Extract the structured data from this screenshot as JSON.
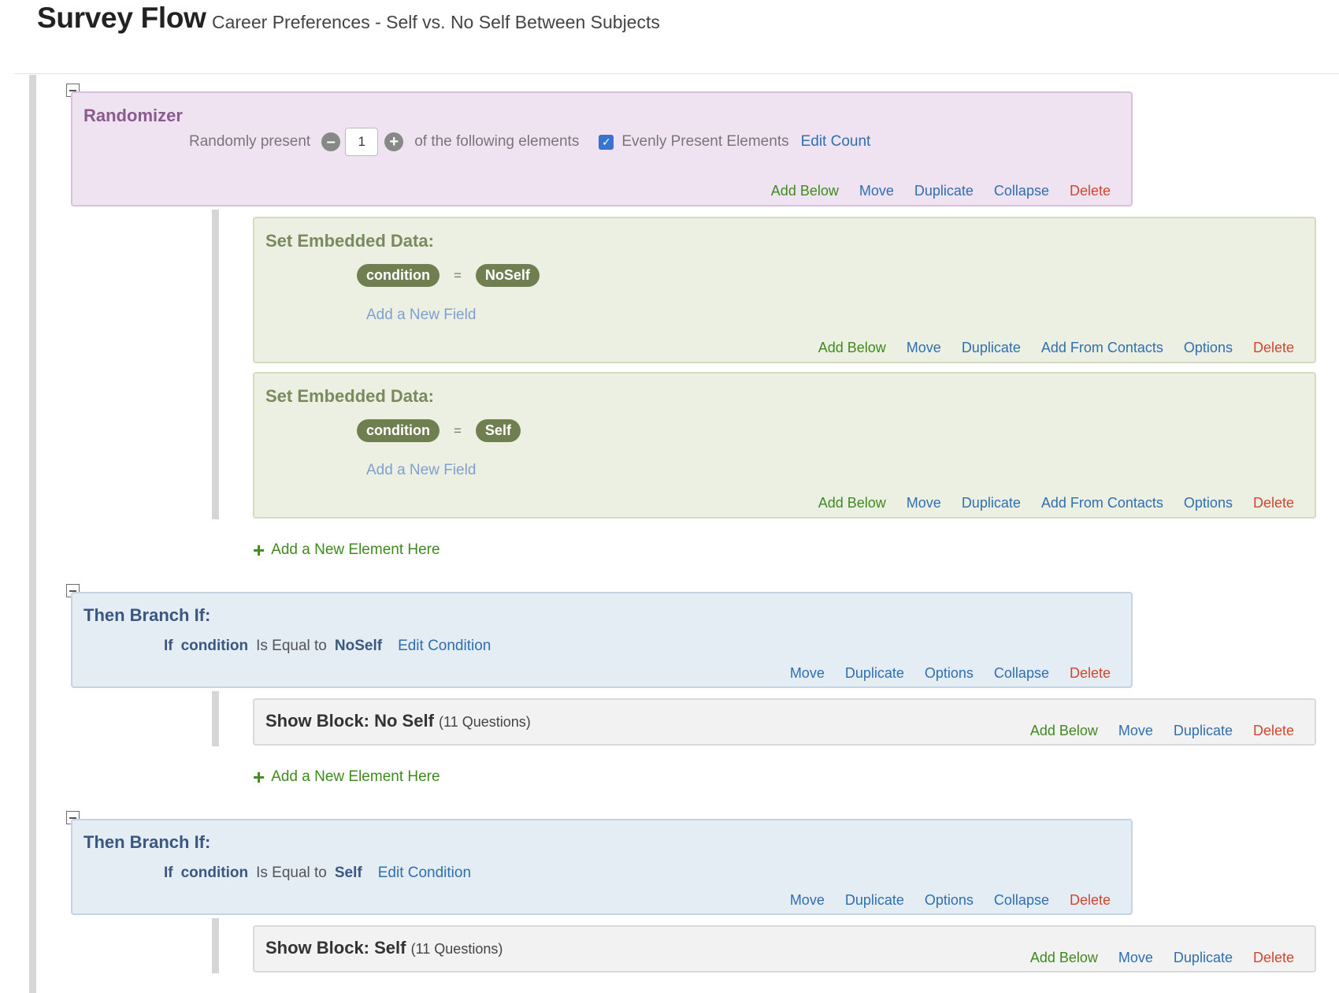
{
  "header": {
    "title": "Survey Flow",
    "subtitle": "Career Preferences - Self vs. No Self Between Subjects"
  },
  "randomizer": {
    "title": "Randomizer",
    "present_label": "Randomly present",
    "count": "1",
    "following_label": "of the following elements",
    "evenly_label": "Evenly Present Elements",
    "evenly_checked": true,
    "edit_count": "Edit Count",
    "actions": [
      "Add Below",
      "Move",
      "Duplicate",
      "Collapse",
      "Delete"
    ]
  },
  "embedded": [
    {
      "title": "Set Embedded Data:",
      "field": "condition",
      "operator": "=",
      "value": "NoSelf",
      "add_field": "Add a New Field",
      "actions": [
        "Add Below",
        "Move",
        "Duplicate",
        "Add From Contacts",
        "Options",
        "Delete"
      ]
    },
    {
      "title": "Set Embedded Data:",
      "field": "condition",
      "operator": "=",
      "value": "Self",
      "add_field": "Add a New Field",
      "actions": [
        "Add Below",
        "Move",
        "Duplicate",
        "Add From Contacts",
        "Options",
        "Delete"
      ]
    }
  ],
  "add_element": "Add a New Element Here",
  "branches": [
    {
      "title": "Then Branch If:",
      "if_kw": "If",
      "field": "condition",
      "op": "Is Equal to",
      "value": "NoSelf",
      "edit": "Edit Condition",
      "actions": [
        "Move",
        "Duplicate",
        "Options",
        "Collapse",
        "Delete"
      ],
      "block": {
        "label": "Show Block: No Self",
        "count": "(11 Questions)",
        "actions": [
          "Add Below",
          "Move",
          "Duplicate",
          "Delete"
        ]
      }
    },
    {
      "title": "Then Branch If:",
      "if_kw": "If",
      "field": "condition",
      "op": "Is Equal to",
      "value": "Self",
      "edit": "Edit Condition",
      "actions": [
        "Move",
        "Duplicate",
        "Options",
        "Collapse",
        "Delete"
      ],
      "block": {
        "label": "Show Block: Self",
        "count": "(11 Questions)",
        "actions": [
          "Add Below",
          "Move",
          "Duplicate",
          "Delete"
        ]
      }
    }
  ],
  "colors": {
    "randomizer_bg": "#efe3f1",
    "embedded_bg": "#ecf0e3",
    "branch_bg": "#e4ecf4",
    "block_bg": "#f2f2f2",
    "action_green": "#3f8a1f",
    "action_blue": "#2f6fb0",
    "action_red": "#d2452f"
  }
}
